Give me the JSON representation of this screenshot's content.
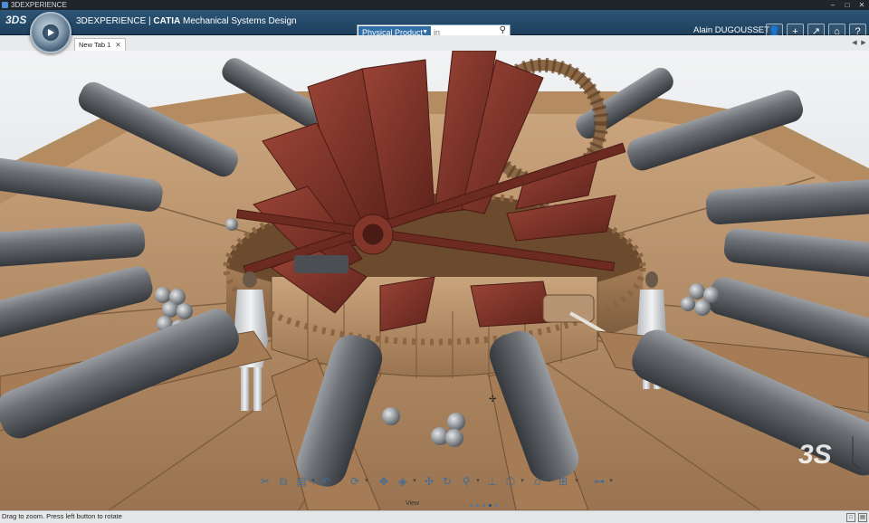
{
  "window": {
    "title": "3DEXPERIENCE",
    "minimize": "–",
    "maximize": "□",
    "close": "✕"
  },
  "app": {
    "brand": "3DS",
    "product_prefix": "3DEXPERIENCE | ",
    "product_name": "CATIA",
    "product_suffix": " Mechanical Systems Design",
    "user": "Alain DUGOUSSET"
  },
  "search": {
    "context": "Physical Product",
    "placeholder": "in"
  },
  "top_icons": [
    "user-icon",
    "add-icon",
    "share-icon",
    "home-icon",
    "help-icon"
  ],
  "tabs": [
    {
      "label": "New Tab 1"
    }
  ],
  "toolbar": {
    "view_label": "View",
    "items": [
      "scissors-icon",
      "copy-icon",
      "paste-icon",
      "undo-icon",
      "cycle-icon",
      "fit-all-icon",
      "cube-icon",
      "pan-icon",
      "rotate-icon",
      "zoom-icon",
      "normal-view-icon",
      "iso-view-icon",
      "cylinder-icon",
      "render-style-icon",
      "tree-icon"
    ]
  },
  "status": {
    "message": "Drag to zoom. Press left button to rotate"
  },
  "colors": {
    "app_bar": "#2d5577",
    "search_context": "#2f6ea7",
    "wood": "#b8916b",
    "paddle": "#7a3228",
    "cannon": "#5f6368"
  }
}
